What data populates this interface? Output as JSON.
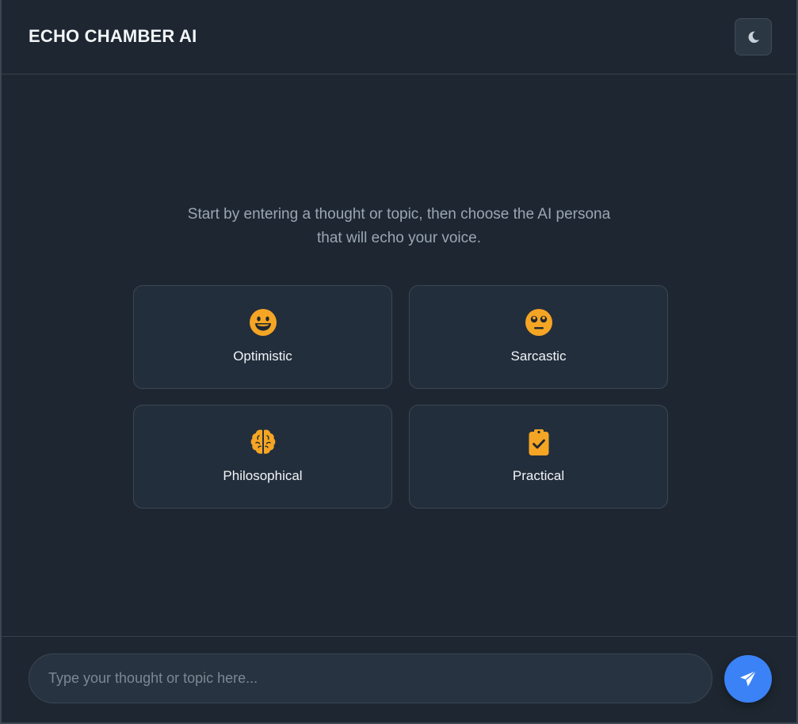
{
  "header": {
    "title": "ECHO CHAMBER AI",
    "theme_toggle_icon": "moon-icon"
  },
  "intro": {
    "line1": "Start by entering a thought or topic, then choose the AI persona",
    "line2": "that will echo your voice."
  },
  "personas": [
    {
      "label": "Optimistic",
      "icon": "grinning-face-icon"
    },
    {
      "label": "Sarcastic",
      "icon": "rolling-eyes-face-icon"
    },
    {
      "label": "Philosophical",
      "icon": "brain-icon"
    },
    {
      "label": "Practical",
      "icon": "clipboard-check-icon"
    }
  ],
  "composer": {
    "placeholder": "Type your thought or topic here...",
    "value": "",
    "send_icon": "paper-plane-icon"
  },
  "colors": {
    "background": "#1e2731",
    "card": "#232e3c",
    "accent": "#3b82f6",
    "icon": "#f5a524"
  }
}
